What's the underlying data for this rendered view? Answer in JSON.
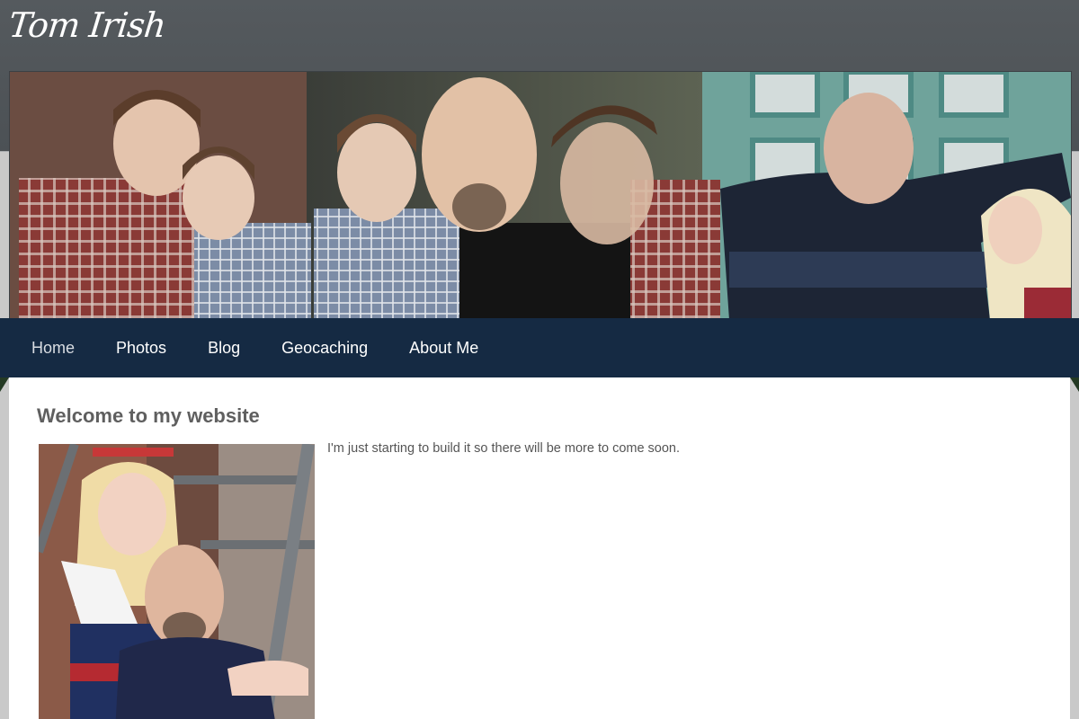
{
  "site": {
    "title": "Tom Irish"
  },
  "nav": {
    "items": [
      {
        "label": "Home",
        "active": true
      },
      {
        "label": "Photos",
        "active": false
      },
      {
        "label": "Blog",
        "active": false
      },
      {
        "label": "Geocaching",
        "active": false
      },
      {
        "label": "About Me",
        "active": false
      }
    ]
  },
  "main": {
    "heading": "Welcome to my website",
    "text": "I'm just starting to build it so there will be more to come soon."
  },
  "colors": {
    "header_bg": "#4f5458",
    "nav_bg": "#152a43",
    "page_bg": "#c9c9c9",
    "content_bg": "#ffffff"
  }
}
